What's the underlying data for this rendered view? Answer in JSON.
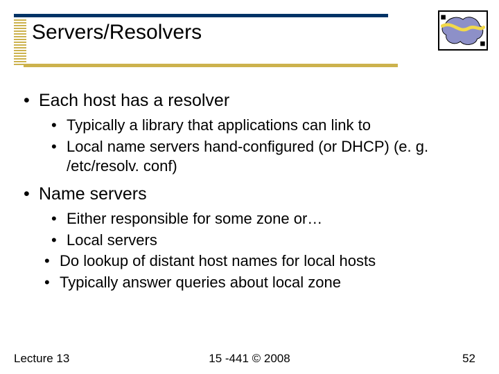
{
  "title": "Servers/Resolvers",
  "bullets": {
    "b1": "Each host has a resolver",
    "b1a": "Typically a library that applications can link to",
    "b1b": "Local name servers hand-configured (or DHCP) (e. g. /etc/resolv. conf)",
    "b2": "Name servers",
    "b2a": "Either responsible for some zone or…",
    "b2b": "Local servers",
    "b2b1": "Do lookup of distant host names for local hosts",
    "b2b2": "Typically answer queries about local zone"
  },
  "footer": {
    "left": "Lecture 13",
    "center": "15 -441 ©  2008",
    "right": "52"
  }
}
